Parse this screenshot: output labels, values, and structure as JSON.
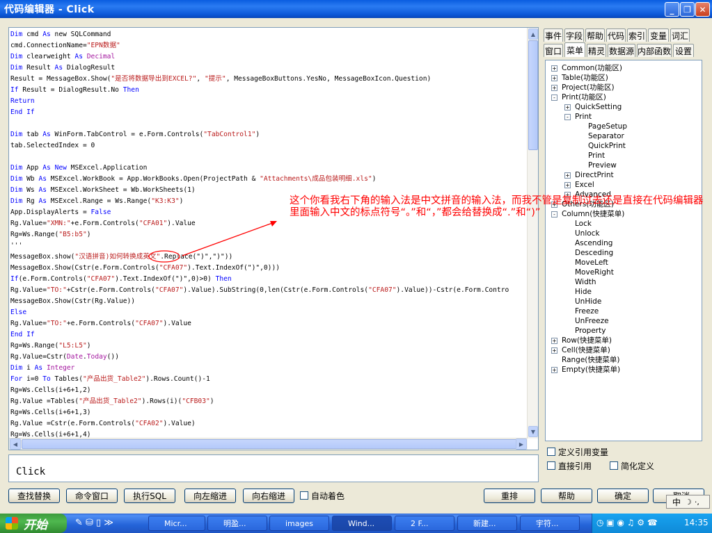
{
  "window": {
    "title": "代码编辑器 - Click",
    "min_label": "_",
    "max_label": "❐",
    "close_label": "✕"
  },
  "code_lines": [
    [
      [
        "kw",
        "Dim"
      ],
      [
        "t",
        " cmd "
      ],
      [
        "kw",
        "As"
      ],
      [
        "t",
        " new SQLCommand"
      ]
    ],
    [
      [
        "t",
        "cmd.ConnectionName="
      ],
      [
        "st",
        "\"EPN数据\""
      ]
    ],
    [
      [
        "kw",
        "Dim"
      ],
      [
        "t",
        " clearweight "
      ],
      [
        "kw",
        "As"
      ],
      [
        "t",
        " "
      ],
      [
        "ty",
        "Decimal"
      ]
    ],
    [
      [
        "kw",
        "Dim"
      ],
      [
        "t",
        " Result "
      ],
      [
        "kw",
        "As"
      ],
      [
        "t",
        " DialogResult"
      ]
    ],
    [
      [
        "t",
        "Result = MessageBox.Show("
      ],
      [
        "st",
        "\"是否将数据导出到EXCEL?\""
      ],
      [
        "t",
        ", "
      ],
      [
        "st",
        "\"提示\""
      ],
      [
        "t",
        ", MessageBoxButtons.YesNo, MessageBoxIcon.Question)"
      ]
    ],
    [
      [
        "kw",
        "If"
      ],
      [
        "t",
        " Result = DialogResult.No "
      ],
      [
        "kw",
        "Then"
      ]
    ],
    [
      [
        "kw",
        "Return"
      ]
    ],
    [
      [
        "kw",
        "End If"
      ]
    ],
    [
      [
        "t",
        ""
      ]
    ],
    [
      [
        "kw",
        "Dim"
      ],
      [
        "t",
        " tab "
      ],
      [
        "kw",
        "As"
      ],
      [
        "t",
        " WinForm.TabControl = e.Form.Controls("
      ],
      [
        "st",
        "\"TabControl1\""
      ],
      [
        "t",
        ")"
      ]
    ],
    [
      [
        "t",
        "tab.SelectedIndex = 0"
      ]
    ],
    [
      [
        "t",
        ""
      ]
    ],
    [
      [
        "kw",
        "Dim"
      ],
      [
        "t",
        " App "
      ],
      [
        "kw",
        "As"
      ],
      [
        "t",
        " "
      ],
      [
        "kw",
        "New"
      ],
      [
        "t",
        " MSExcel.Application"
      ]
    ],
    [
      [
        "kw",
        "Dim"
      ],
      [
        "t",
        " Wb "
      ],
      [
        "kw",
        "As"
      ],
      [
        "t",
        " MSExcel.WorkBook = App.WorkBooks.Open(ProjectPath & "
      ],
      [
        "st",
        "\"Attachments\\成品包装明细.xls\""
      ],
      [
        "t",
        ")"
      ]
    ],
    [
      [
        "kw",
        "Dim"
      ],
      [
        "t",
        " Ws "
      ],
      [
        "kw",
        "As"
      ],
      [
        "t",
        " MSExcel.WorkSheet = Wb.WorkSheets(1)"
      ]
    ],
    [
      [
        "kw",
        "Dim"
      ],
      [
        "t",
        " Rg "
      ],
      [
        "kw",
        "As"
      ],
      [
        "t",
        " MSExcel.Range = Ws.Range("
      ],
      [
        "st",
        "\"K3:K3\""
      ],
      [
        "t",
        ")"
      ]
    ],
    [
      [
        "t",
        "App.DisplayAlerts = "
      ],
      [
        "kw",
        "False"
      ]
    ],
    [
      [
        "t",
        "Rg.Value="
      ],
      [
        "st",
        "\"XMN:\""
      ],
      [
        "t",
        "+e.Form.Controls("
      ],
      [
        "st",
        "\"CFA01\""
      ],
      [
        "t",
        ").Value"
      ]
    ],
    [
      [
        "t",
        "Rg=Ws.Range("
      ],
      [
        "st",
        "\"B5:b5\""
      ],
      [
        "t",
        ")"
      ]
    ],
    [
      [
        "t",
        "'''"
      ]
    ],
    [
      [
        "t",
        "MessageBox.show("
      ],
      [
        "st",
        "\"汉语拼音)如何转换成英文\""
      ],
      [
        "t",
        ".Replace(\")\",\")\"))"
      ]
    ],
    [
      [
        "t",
        "MessageBox.Show(Cstr(e.Form.Controls("
      ],
      [
        "st",
        "\"CFA07\""
      ],
      [
        "t",
        ").Text.IndexOf(\")\",0)))"
      ]
    ],
    [
      [
        "kw",
        "If"
      ],
      [
        "t",
        "(e.Form.Controls("
      ],
      [
        "st",
        "\"CFA07\""
      ],
      [
        "t",
        ").Text.IndexOf(\")\",0)>0) "
      ],
      [
        "kw",
        "Then"
      ]
    ],
    [
      [
        "t",
        "Rg.Value="
      ],
      [
        "st",
        "\"TO:\""
      ],
      [
        "t",
        "+Cstr(e.Form.Controls("
      ],
      [
        "st",
        "\"CFA07\""
      ],
      [
        "t",
        ").Value).SubString(0,len(Cstr(e.Form.Controls("
      ],
      [
        "st",
        "\"CFA07\""
      ],
      [
        "t",
        ").Value))-Cstr(e.Form.Contro"
      ]
    ],
    [
      [
        "t",
        "MessageBox.Show(Cstr(Rg.Value))"
      ]
    ],
    [
      [
        "kw",
        "Else"
      ]
    ],
    [
      [
        "t",
        "Rg.Value="
      ],
      [
        "st",
        "\"TO:\""
      ],
      [
        "t",
        "+e.Form.Controls("
      ],
      [
        "st",
        "\"CFA07\""
      ],
      [
        "t",
        ").Value"
      ]
    ],
    [
      [
        "kw",
        "End If"
      ]
    ],
    [
      [
        "t",
        "Rg=Ws.Range("
      ],
      [
        "st",
        "\"L5:L5\""
      ],
      [
        "t",
        ")"
      ]
    ],
    [
      [
        "t",
        "Rg.Value=Cstr("
      ],
      [
        "ty",
        "Date"
      ],
      [
        "t",
        "."
      ],
      [
        "ty",
        "Today"
      ],
      [
        "t",
        "())"
      ]
    ],
    [
      [
        "kw",
        "Dim"
      ],
      [
        "t",
        " i "
      ],
      [
        "kw",
        "As"
      ],
      [
        "t",
        " "
      ],
      [
        "ty",
        "Integer"
      ]
    ],
    [
      [
        "kw",
        "For"
      ],
      [
        "t",
        " i=0 "
      ],
      [
        "kw",
        "To"
      ],
      [
        "t",
        " Tables("
      ],
      [
        "st",
        "\"产品出货_Table2\""
      ],
      [
        "t",
        ").Rows.Count()-1"
      ]
    ],
    [
      [
        "t",
        "Rg=Ws.Cells(i+6+1,2)"
      ]
    ],
    [
      [
        "t",
        "Rg.Value =Tables("
      ],
      [
        "st",
        "\"产品出货_Table2\""
      ],
      [
        "t",
        ").Rows(i)("
      ],
      [
        "st",
        "\"CFB03\""
      ],
      [
        "t",
        ")"
      ]
    ],
    [
      [
        "t",
        "Rg=Ws.Cells(i+6+1,3)"
      ]
    ],
    [
      [
        "t",
        "Rg.Value =Cstr(e.Form.Controls("
      ],
      [
        "st",
        "\"CFA02\""
      ],
      [
        "t",
        ").Value)"
      ]
    ],
    [
      [
        "t",
        "Rg=Ws.Cells(i+6+1,4)"
      ]
    ]
  ],
  "output_text": "Click",
  "annotation": "这个你看我右下角的输入法是中文拼音的输入法，而我不管是复制过去还是直接在代码编辑器里面输入中文的标点符号“。”和“，”都会给替换成“.”和“)”",
  "tabs_row1": [
    "事件",
    "字段",
    "帮助",
    "代码",
    "索引",
    "变量",
    "词汇"
  ],
  "tabs_row2": [
    "窗口",
    "菜单",
    "精灵",
    "数据源",
    "内部函数",
    "设置"
  ],
  "tree": [
    {
      "label": "Common(功能区)",
      "exp": "+"
    },
    {
      "label": "Table(功能区)",
      "exp": "+"
    },
    {
      "label": "Project(功能区)",
      "exp": "+"
    },
    {
      "label": "Print(功能区)",
      "exp": "-"
    },
    {
      "label": "QuickSetting",
      "exp": "+"
    },
    {
      "label": "Print",
      "exp": "-"
    },
    {
      "label": "PageSetup",
      "exp": ""
    },
    {
      "label": "Separator",
      "exp": ""
    },
    {
      "label": "QuickPrint",
      "exp": ""
    },
    {
      "label": "Print",
      "exp": ""
    },
    {
      "label": "Preview",
      "exp": ""
    },
    {
      "label": "DirectPrint",
      "exp": "+"
    },
    {
      "label": "Excel",
      "exp": "+"
    },
    {
      "label": "Advanced",
      "exp": "+"
    },
    {
      "label": "Others(功能区)",
      "exp": "+"
    },
    {
      "label": "Column(快捷菜单)",
      "exp": "-"
    },
    {
      "label": "Lock",
      "exp": ""
    },
    {
      "label": "Unlock",
      "exp": ""
    },
    {
      "label": "Ascending",
      "exp": ""
    },
    {
      "label": "Desceding",
      "exp": ""
    },
    {
      "label": "MoveLeft",
      "exp": ""
    },
    {
      "label": "MoveRight",
      "exp": ""
    },
    {
      "label": "Width",
      "exp": ""
    },
    {
      "label": "Hide",
      "exp": ""
    },
    {
      "label": "UnHide",
      "exp": ""
    },
    {
      "label": "Freeze",
      "exp": ""
    },
    {
      "label": "UnFreeze",
      "exp": ""
    },
    {
      "label": "Property",
      "exp": ""
    },
    {
      "label": "Row(快捷菜单)",
      "exp": "+"
    },
    {
      "label": "Cell(快捷菜单)",
      "exp": "+"
    },
    {
      "label": "Range(快捷菜单)",
      "exp": ""
    },
    {
      "label": "Empty(快捷菜单)",
      "exp": "+"
    }
  ],
  "options": {
    "define_ref_var": "定义引用变量",
    "direct_ref": "直接引用",
    "simple_def": "简化定义",
    "auto_color": "自动着色"
  },
  "buttons": {
    "find_replace": "查找替换",
    "cmd_window": "命令窗口",
    "exec_sql": "执行SQL",
    "indent_left": "向左缩进",
    "indent_right": "向右缩进",
    "rearrange": "重排",
    "help": "帮助",
    "ok": "确定",
    "cancel": "取消"
  },
  "ime": {
    "label": "中"
  },
  "taskbar": {
    "start": "开始",
    "tasks": [
      {
        "label": "Micr..."
      },
      {
        "label": "明盈..."
      },
      {
        "label": "images"
      },
      {
        "label": "Wind..."
      },
      {
        "label": "2 F..."
      },
      {
        "label": "新建..."
      },
      {
        "label": "宇符..."
      }
    ],
    "clock": "14:35"
  }
}
